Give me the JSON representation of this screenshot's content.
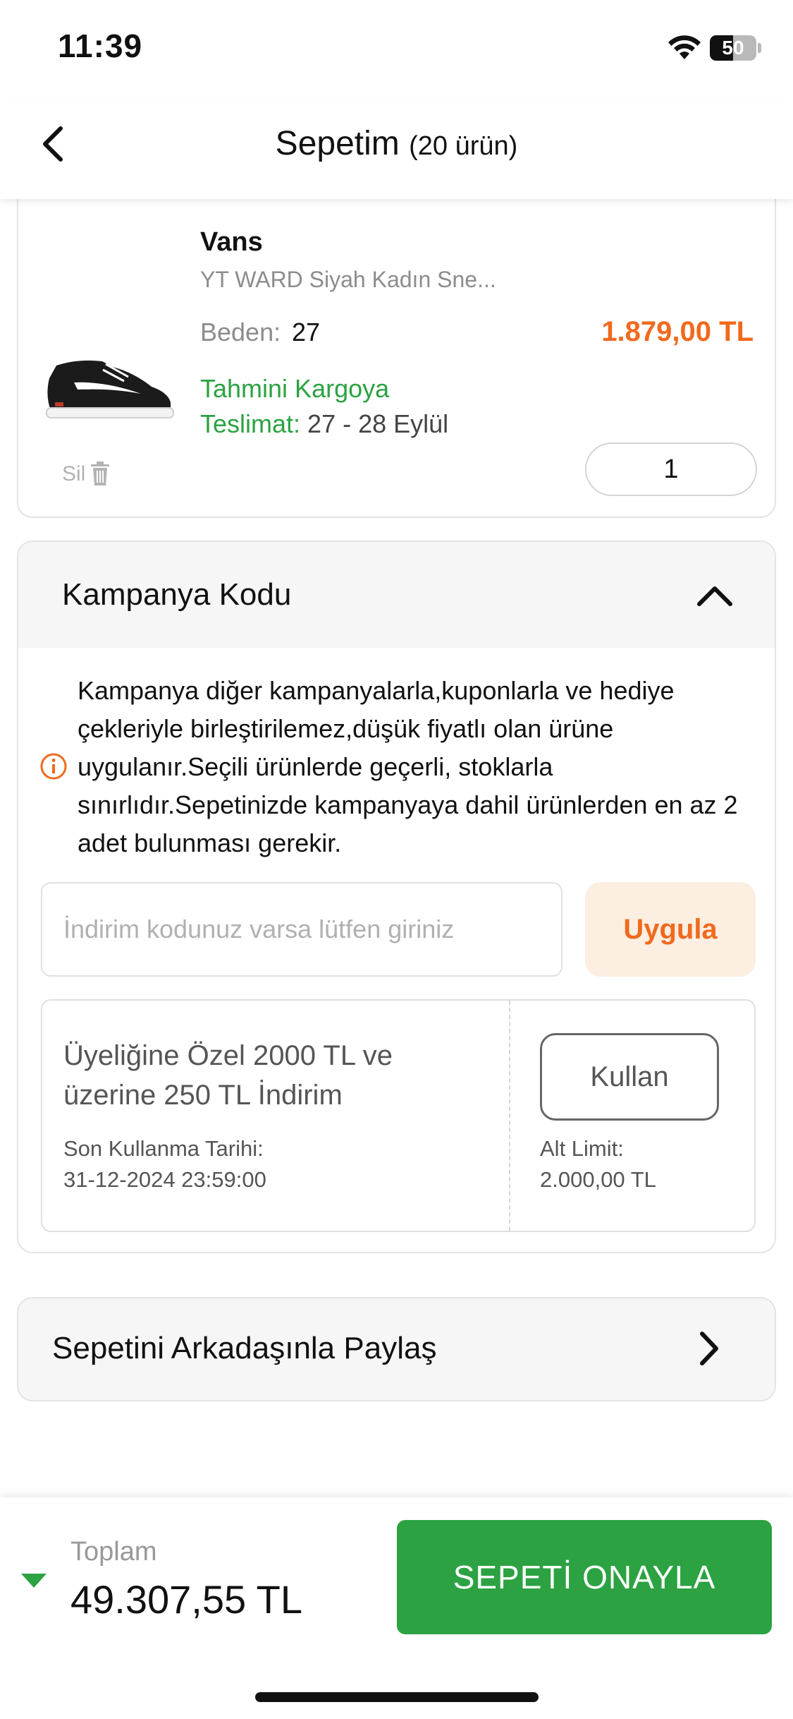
{
  "status_bar": {
    "time": "11:39",
    "battery_level": "50",
    "battery_fraction": 0.5
  },
  "nav": {
    "title": "Sepetim",
    "item_count": "(20 ürün)"
  },
  "product": {
    "brand": "Vans",
    "name": "YT WARD Siyah Kadın Sne...",
    "size_label": "Beden:",
    "size_value": "27",
    "price": "1.879,00 TL",
    "cargo_line1": "Tahmini Kargoya",
    "cargo_label": "Teslimat:",
    "cargo_dates": "27 - 28 Eylül",
    "delete_label": "Sil",
    "quantity": "1"
  },
  "campaign": {
    "title": "Kampanya Kodu",
    "info": "Kampanya diğer kampanyalarla,kuponlarla ve hediye çekleriyle birleştirilemez,düşük fiyatlı olan ürüne uygulanır.Seçili ürünlerde geçerli, stoklarla sınırlıdır.Sepetinizde kampanyaya dahil ürünlerden en az 2 adet bulunması gerekir.",
    "input_placeholder": "İndirim kodunuz varsa lütfen giriniz",
    "input_value": "",
    "apply_label": "Uygula",
    "coupon": {
      "title": "Üyeliğine Özel 2000 TL ve üzerine 250 TL İndirim",
      "expiry_label": "Son Kullanma Tarihi:",
      "expiry_value": "31-12-2024 23:59:00",
      "use_label": "Kullan",
      "limit_label": "Alt Limit:",
      "limit_value": "2.000,00 TL"
    }
  },
  "share": {
    "label": "Sepetini Arkadaşınla Paylaş"
  },
  "footer": {
    "total_label": "Toplam",
    "total_value": "49.307,55 TL",
    "confirm_label": "SEPETİ ONAYLA"
  },
  "colors": {
    "accent_green": "#2ca242",
    "accent_orange": "#f06a1e",
    "apply_bg": "#fdeee2"
  },
  "icons": [
    "back-arrow-icon",
    "wifi-icon",
    "battery-icon",
    "shoe-image",
    "trash-icon",
    "chevron-up-icon",
    "info-icon",
    "chevron-right-icon",
    "caret-down-icon"
  ]
}
